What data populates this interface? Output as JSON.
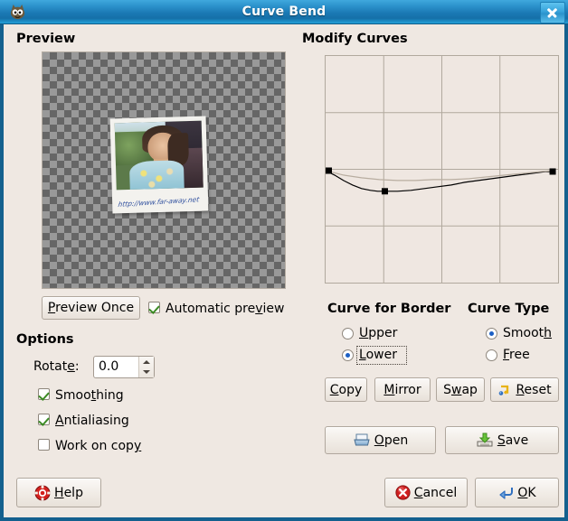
{
  "window": {
    "title": "Curve Bend",
    "app_icon": "wilber-icon",
    "close_icon": "close-icon",
    "bg_color": "#efe8e2",
    "titlebar_color": "#1b79b4"
  },
  "preview": {
    "section_title": "Preview",
    "canvas_icon": "checkerboard-transparency",
    "photo_caption": "http://www.far-away.net",
    "preview_once_label": "Preview Once",
    "preview_once_mnemonic": "P",
    "automatic_preview": {
      "label": "Automatic preview",
      "checked": true
    }
  },
  "options": {
    "section_title": "Options",
    "rotate": {
      "label": "Rotate:",
      "value": "0.0"
    },
    "checkboxes": [
      {
        "label": "Smoothing",
        "checked": true
      },
      {
        "label": "Antialiasing",
        "checked": true
      },
      {
        "label": "Work on copy",
        "checked": false
      }
    ]
  },
  "curves": {
    "section_title": "Modify Curves",
    "border_group_title": "Curve for Border",
    "type_group_title": "Curve Type",
    "border_options": [
      {
        "label": "Upper",
        "selected": false,
        "focused": false
      },
      {
        "label": "Lower",
        "selected": true,
        "focused": true
      }
    ],
    "type_options": [
      {
        "label": "Smooth",
        "selected": true,
        "focused": false
      },
      {
        "label": "Free",
        "selected": false,
        "focused": false
      }
    ],
    "actions": [
      {
        "label": "Copy",
        "icon": null
      },
      {
        "label": "Mirror",
        "icon": null
      },
      {
        "label": "Swap",
        "icon": null
      },
      {
        "label": "Reset",
        "icon": "reset-icon"
      }
    ],
    "file_actions": [
      {
        "label": "Open",
        "icon": "open-folder-icon"
      },
      {
        "label": "Save",
        "icon": "save-disk-icon"
      }
    ]
  },
  "chart_data": {
    "type": "line",
    "title": "Modify Curves",
    "xlabel": "",
    "ylabel": "",
    "xlim": [
      0,
      259
    ],
    "ylim": [
      0,
      253
    ],
    "grid": true,
    "grid_divisions": 4,
    "legend": "none",
    "series": [
      {
        "name": "lower-curve",
        "color": "#000000",
        "control_points": [
          [
            0,
            128
          ],
          [
            66,
            151
          ],
          [
            253,
            129
          ]
        ],
        "path_points": [
          [
            0,
            128
          ],
          [
            10,
            133
          ],
          [
            20,
            139
          ],
          [
            30,
            144
          ],
          [
            40,
            148
          ],
          [
            50,
            150
          ],
          [
            58,
            151
          ],
          [
            66,
            151
          ],
          [
            80,
            151
          ],
          [
            95,
            150
          ],
          [
            110,
            148
          ],
          [
            125,
            146
          ],
          [
            140,
            144
          ],
          [
            155,
            141
          ],
          [
            170,
            139
          ],
          [
            185,
            137
          ],
          [
            200,
            135
          ],
          [
            215,
            133
          ],
          [
            230,
            131
          ],
          [
            245,
            129
          ],
          [
            253,
            129
          ]
        ]
      },
      {
        "name": "upper-curve",
        "color": "#b8ada0",
        "control_points": [
          [
            0,
            128
          ],
          [
            253,
            128
          ]
        ],
        "path_points": [
          [
            0,
            128
          ],
          [
            20,
            133
          ],
          [
            40,
            136
          ],
          [
            60,
            138
          ],
          [
            80,
            139
          ],
          [
            100,
            139
          ],
          [
            120,
            138
          ],
          [
            140,
            138
          ],
          [
            160,
            137
          ],
          [
            180,
            135
          ],
          [
            200,
            133
          ],
          [
            220,
            131
          ],
          [
            240,
            129
          ],
          [
            253,
            128
          ]
        ]
      }
    ]
  },
  "footer": {
    "buttons": [
      {
        "label": "Help",
        "icon": "lifebuoy-icon"
      },
      {
        "label": "Cancel",
        "icon": "cancel-x-icon"
      },
      {
        "label": "OK",
        "icon": "ok-return-icon"
      }
    ]
  }
}
